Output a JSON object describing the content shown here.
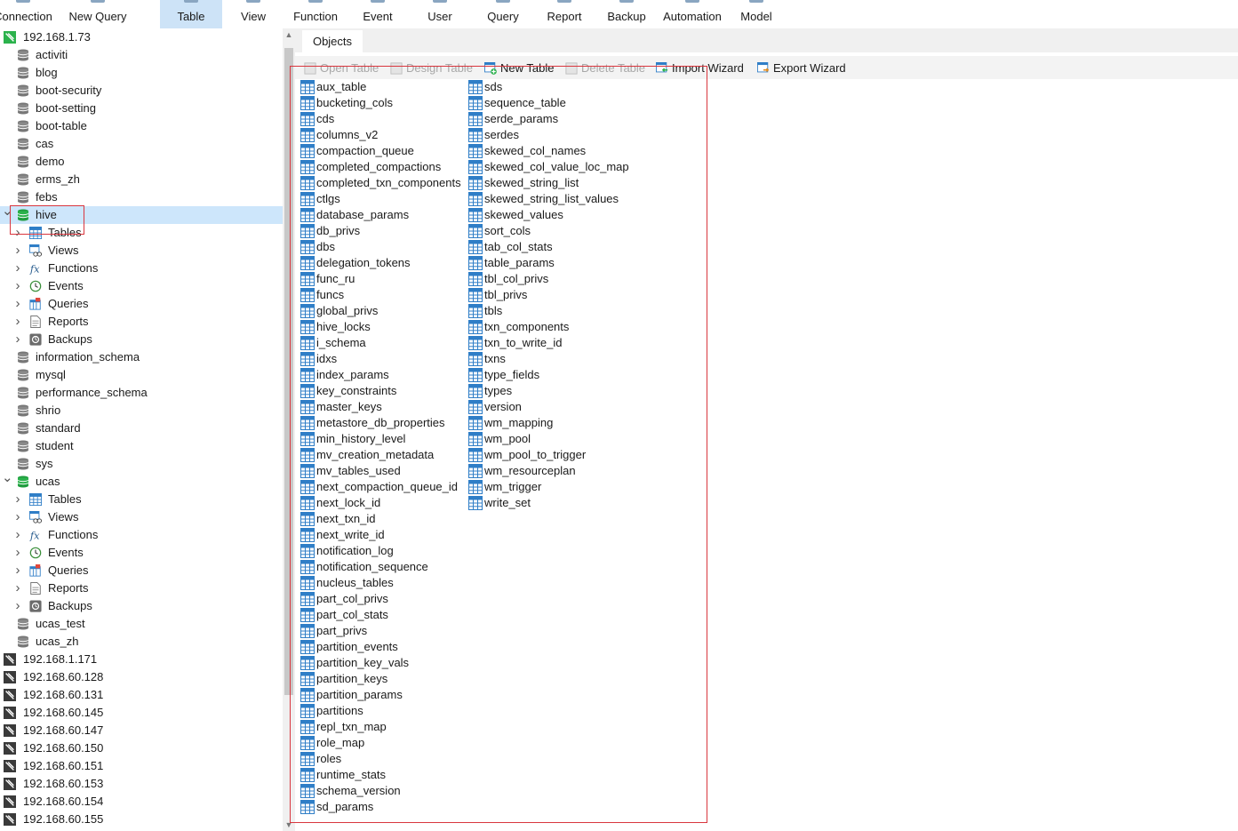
{
  "toolbar": {
    "items": [
      {
        "label": "Connection",
        "icon": "plug-icon"
      },
      {
        "label": "New Query",
        "icon": "new-query-icon"
      },
      {
        "label": "Table",
        "icon": "table-icon",
        "active": true
      },
      {
        "label": "View",
        "icon": "view-icon"
      },
      {
        "label": "Function",
        "icon": "function-icon"
      },
      {
        "label": "Event",
        "icon": "event-icon"
      },
      {
        "label": "User",
        "icon": "user-icon"
      },
      {
        "label": "Query",
        "icon": "query-icon"
      },
      {
        "label": "Report",
        "icon": "report-icon"
      },
      {
        "label": "Backup",
        "icon": "backup-icon"
      },
      {
        "label": "Automation",
        "icon": "automation-icon"
      },
      {
        "label": "Model",
        "icon": "model-icon"
      }
    ]
  },
  "sidebar": {
    "connection": "192.168.1.73",
    "databases_before_hive": [
      "activiti",
      "blog",
      "boot-security",
      "boot-setting",
      "boot-table",
      "cas",
      "demo",
      "erms_zh",
      "febs"
    ],
    "hive": {
      "label": "hive",
      "children": [
        "Tables",
        "Views",
        "Functions",
        "Events",
        "Queries",
        "Reports",
        "Backups"
      ]
    },
    "databases_after_hive": [
      "information_schema",
      "mysql",
      "performance_schema",
      "shrio",
      "standard",
      "student",
      "sys"
    ],
    "ucas": {
      "label": "ucas",
      "children": [
        "Tables",
        "Views",
        "Functions",
        "Events",
        "Queries",
        "Reports",
        "Backups"
      ]
    },
    "databases_after_ucas": [
      "ucas_test",
      "ucas_zh"
    ],
    "other_connections": [
      "192.168.1.171",
      "192.168.60.128",
      "192.168.60.131",
      "192.168.60.145",
      "192.168.60.147",
      "192.168.60.150",
      "192.168.60.151",
      "192.168.60.153",
      "192.168.60.154",
      "192.168.60.155"
    ]
  },
  "tabs": {
    "objects": "Objects"
  },
  "object_toolbar": {
    "items": [
      {
        "label": "Open Table",
        "enabled": false
      },
      {
        "label": "Design Table",
        "enabled": false
      },
      {
        "label": "New Table",
        "enabled": true
      },
      {
        "label": "Delete Table",
        "enabled": false
      },
      {
        "label": "Import Wizard",
        "enabled": true
      },
      {
        "label": "Export Wizard",
        "enabled": true
      }
    ]
  },
  "tables": {
    "column1": [
      "aux_table",
      "bucketing_cols",
      "cds",
      "columns_v2",
      "compaction_queue",
      "completed_compactions",
      "completed_txn_components",
      "ctlgs",
      "database_params",
      "db_privs",
      "dbs",
      "delegation_tokens",
      "func_ru",
      "funcs",
      "global_privs",
      "hive_locks",
      "i_schema",
      "idxs",
      "index_params",
      "key_constraints",
      "master_keys",
      "metastore_db_properties",
      "min_history_level",
      "mv_creation_metadata",
      "mv_tables_used",
      "next_compaction_queue_id",
      "next_lock_id",
      "next_txn_id",
      "next_write_id",
      "notification_log",
      "notification_sequence",
      "nucleus_tables",
      "part_col_privs",
      "part_col_stats",
      "part_privs",
      "partition_events",
      "partition_key_vals",
      "partition_keys",
      "partition_params",
      "partitions",
      "repl_txn_map",
      "role_map",
      "roles",
      "runtime_stats",
      "schema_version",
      "sd_params"
    ],
    "column2": [
      "sds",
      "sequence_table",
      "serde_params",
      "serdes",
      "skewed_col_names",
      "skewed_col_value_loc_map",
      "skewed_string_list",
      "skewed_string_list_values",
      "skewed_values",
      "sort_cols",
      "tab_col_stats",
      "table_params",
      "tbl_col_privs",
      "tbl_privs",
      "tbls",
      "txn_components",
      "txn_to_write_id",
      "txns",
      "type_fields",
      "types",
      "version",
      "wm_mapping",
      "wm_pool",
      "wm_pool_to_trigger",
      "wm_resourceplan",
      "wm_trigger",
      "write_set"
    ]
  },
  "colors": {
    "selection": "#cde6fb",
    "active_tab": "#cde3f7",
    "highlight_box": "#d9363e",
    "db_active": "#2bb24c"
  }
}
